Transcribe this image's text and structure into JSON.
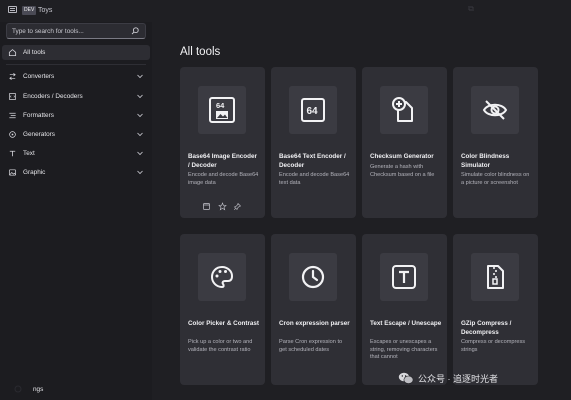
{
  "titlebar": {
    "badge": "DEV",
    "title": "Toys"
  },
  "search": {
    "placeholder": "Type to search for tools..."
  },
  "sidebar": {
    "items": [
      {
        "label": "All tools",
        "icon": "home-icon",
        "active": true
      },
      {
        "label": "Converters",
        "icon": "converter-icon"
      },
      {
        "label": "Encoders / Decoders",
        "icon": "encoder-icon"
      },
      {
        "label": "Formatters",
        "icon": "formatter-icon"
      },
      {
        "label": "Generators",
        "icon": "generator-icon"
      },
      {
        "label": "Text",
        "icon": "text-icon"
      },
      {
        "label": "Graphic",
        "icon": "graphic-icon"
      }
    ],
    "settings_label": "ngs"
  },
  "main": {
    "title": "All tools",
    "cards": [
      {
        "title": "Base64 Image Encoder / Decoder",
        "desc": "Encode and decode Base64 image data",
        "icon": "base64-image-icon"
      },
      {
        "title": "Base64 Text Encoder / Decoder",
        "desc": "Encode and decode Base64 text data",
        "icon": "base64-text-icon"
      },
      {
        "title": "Checksum Generator",
        "desc": "Generate a hash with Checksum based on a file",
        "icon": "checksum-file-icon"
      },
      {
        "title": "Color Blindness Simulator",
        "desc": "Simulate color blindness on a picture or screenshot",
        "icon": "eye-slash-icon"
      },
      {
        "title": "Color Picker & Contrast",
        "desc": "Pick up a color or two and validate the contrast ratio",
        "icon": "palette-icon"
      },
      {
        "title": "Cron expression parser",
        "desc": "Parse Cron expression to get scheduled dates",
        "icon": "clock-icon"
      },
      {
        "title": "Text Escape / Unescape",
        "desc": "Escapes or unescapes a string, removing characters that cannot",
        "icon": "text-escape-icon"
      },
      {
        "title": "GZip Compress / Decompress",
        "desc": "Compress or decompress strings",
        "icon": "zip-file-icon"
      }
    ]
  },
  "watermark": {
    "text": "公众号 · 追逐时光者"
  },
  "colors": {
    "background": "#1f1f23",
    "sidebar": "#1c1c20",
    "card": "#2f2f35",
    "tile": "#3b3b42"
  }
}
